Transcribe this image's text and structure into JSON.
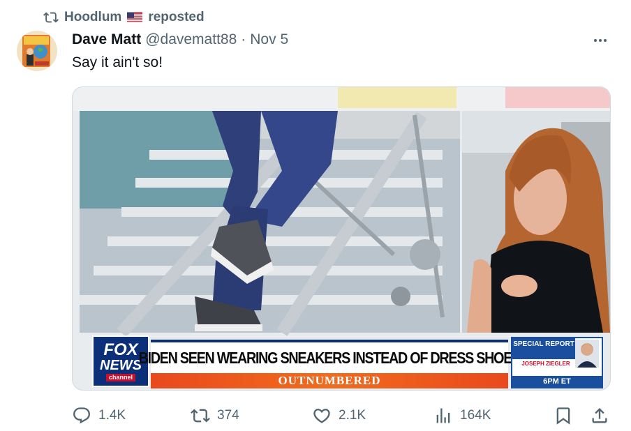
{
  "repost": {
    "name": "Hoodlum",
    "label": "reposted"
  },
  "tweet": {
    "display_name": "Dave Matt",
    "handle": "@davematt88",
    "separator": "·",
    "date": "Nov 5",
    "text": "Say it ain't so!"
  },
  "media": {
    "headline": "BIDEN SEEN WEARING SNEAKERS INSTEAD OF DRESS SHOES",
    "show": "OUTNUMBERED",
    "logo_line1": "FOX",
    "logo_line2": "NEWS",
    "logo_line3": "channel",
    "promo_title": "SPECIAL REPORT",
    "promo_name": "JOSEPH ZIEGLER",
    "promo_time": "6PM ET"
  },
  "actions": {
    "replies": "1.4K",
    "reposts": "374",
    "likes": "2.1K",
    "views": "164K"
  },
  "colors": {
    "text_primary": "#0f1419",
    "text_secondary": "#536471",
    "fox_blue": "#0c2f7a",
    "fox_orange": "#f26b1d"
  }
}
